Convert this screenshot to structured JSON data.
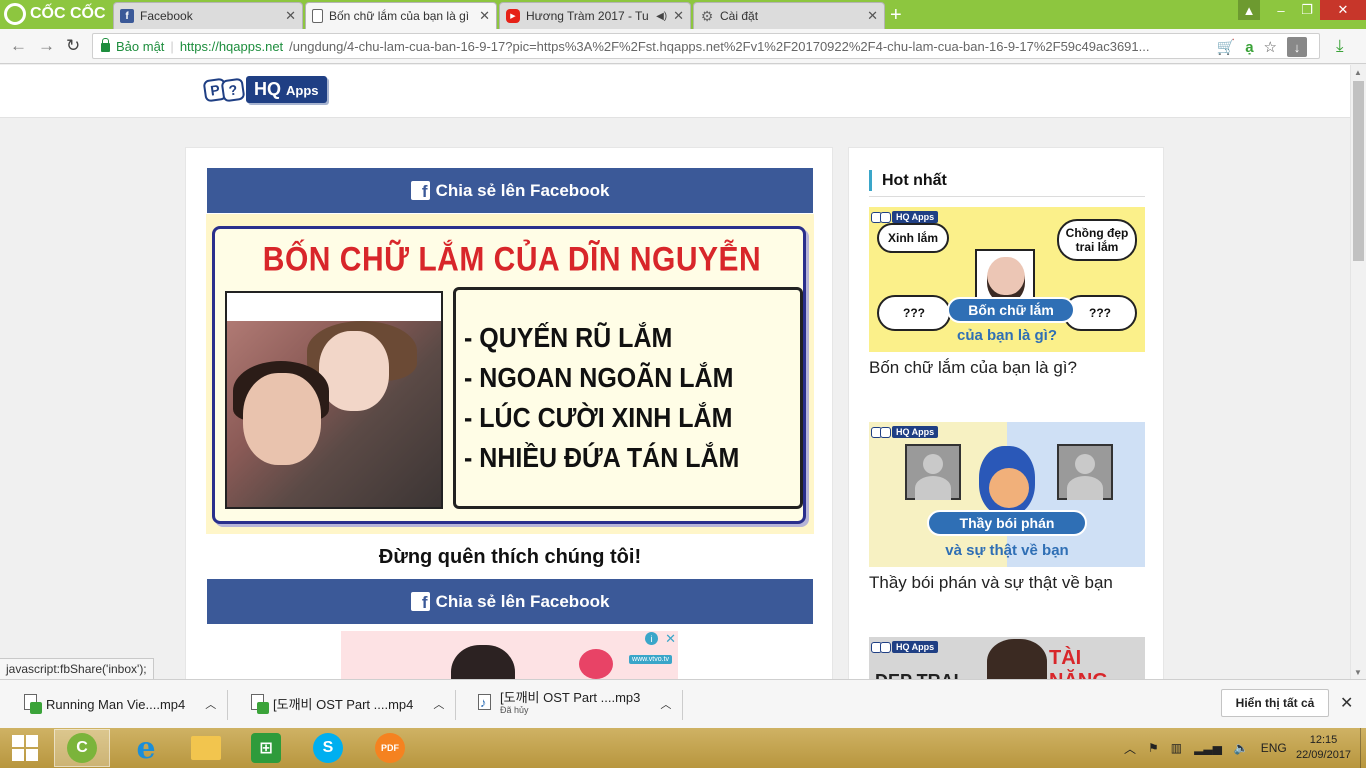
{
  "browser": {
    "brand": "CỐC CỐC",
    "tabs": [
      {
        "label": "Facebook",
        "icon": "facebook-icon"
      },
      {
        "label": "Bốn chữ lắm của bạn là gì",
        "icon": "document-icon"
      },
      {
        "label": "Hương Tràm 2017 - Tu",
        "icon": "youtube-icon"
      },
      {
        "label": "Cài đặt",
        "icon": "gear-icon"
      }
    ],
    "secure_label": "Bảo mật",
    "url_host": "https://hqapps.net",
    "url_path": "/ungdung/4-chu-lam-cua-ban-16-9-17?pic=https%3A%2F%2Fst.hqapps.net%2Fv1%2F20170922%2F4-chu-lam-cua-ban-16-9-17%2F59c49ac3691..."
  },
  "site": {
    "logo_text": "HQ",
    "logo_small": "Apps",
    "logo_bubble_1": "P",
    "logo_bubble_2": "?"
  },
  "main": {
    "share_label": "Chia sẻ lên Facebook",
    "result_title": "BỐN CHỮ LẮM CỦA DĨN NGUYỄN",
    "result_items": [
      "- QUYẾN RŨ LẮM",
      "- NGOAN NGOÃN LẮM",
      "- LÚC CƯỜI XINH LẮM",
      "- NHIỀU ĐỨA TÁN LẮM"
    ],
    "like_text": "Đừng quên thích chúng tôi!",
    "ad_brand": "www.vtvo.tv"
  },
  "sidebar": {
    "title": "Hot nhất",
    "items": [
      {
        "caption": "Bốn chữ lắm của bạn là gì?",
        "clouds": [
          "Xinh lắm",
          "Chồng đẹp trai lắm",
          "???",
          "???"
        ],
        "banner": "Bốn chữ lắm",
        "sub": "của bạn là gì?"
      },
      {
        "caption": "Thầy bói phán và sự thật về bạn",
        "banner": "Thầy bói phán",
        "sub": "và sự thật về bạn"
      },
      {
        "caption": "",
        "tag": "TÀI NĂNG",
        "tag2": "ĐẸP TRAI"
      }
    ],
    "mini_logo": "HQ Apps"
  },
  "status_tip": "javascript:fbShare('inbox');",
  "downloads": {
    "items": [
      {
        "name": "Running Man Vie....mp4",
        "sub": ""
      },
      {
        "name": "[도깨비 OST Part ....mp4",
        "sub": ""
      },
      {
        "name": "[도깨비 OST Part ....mp3",
        "sub": "Đã hủy"
      }
    ],
    "show_all": "Hiển thị tất cả"
  },
  "taskbar": {
    "lang": "ENG",
    "time": "12:15",
    "date": "22/09/2017",
    "pdf_label": "PDF"
  }
}
